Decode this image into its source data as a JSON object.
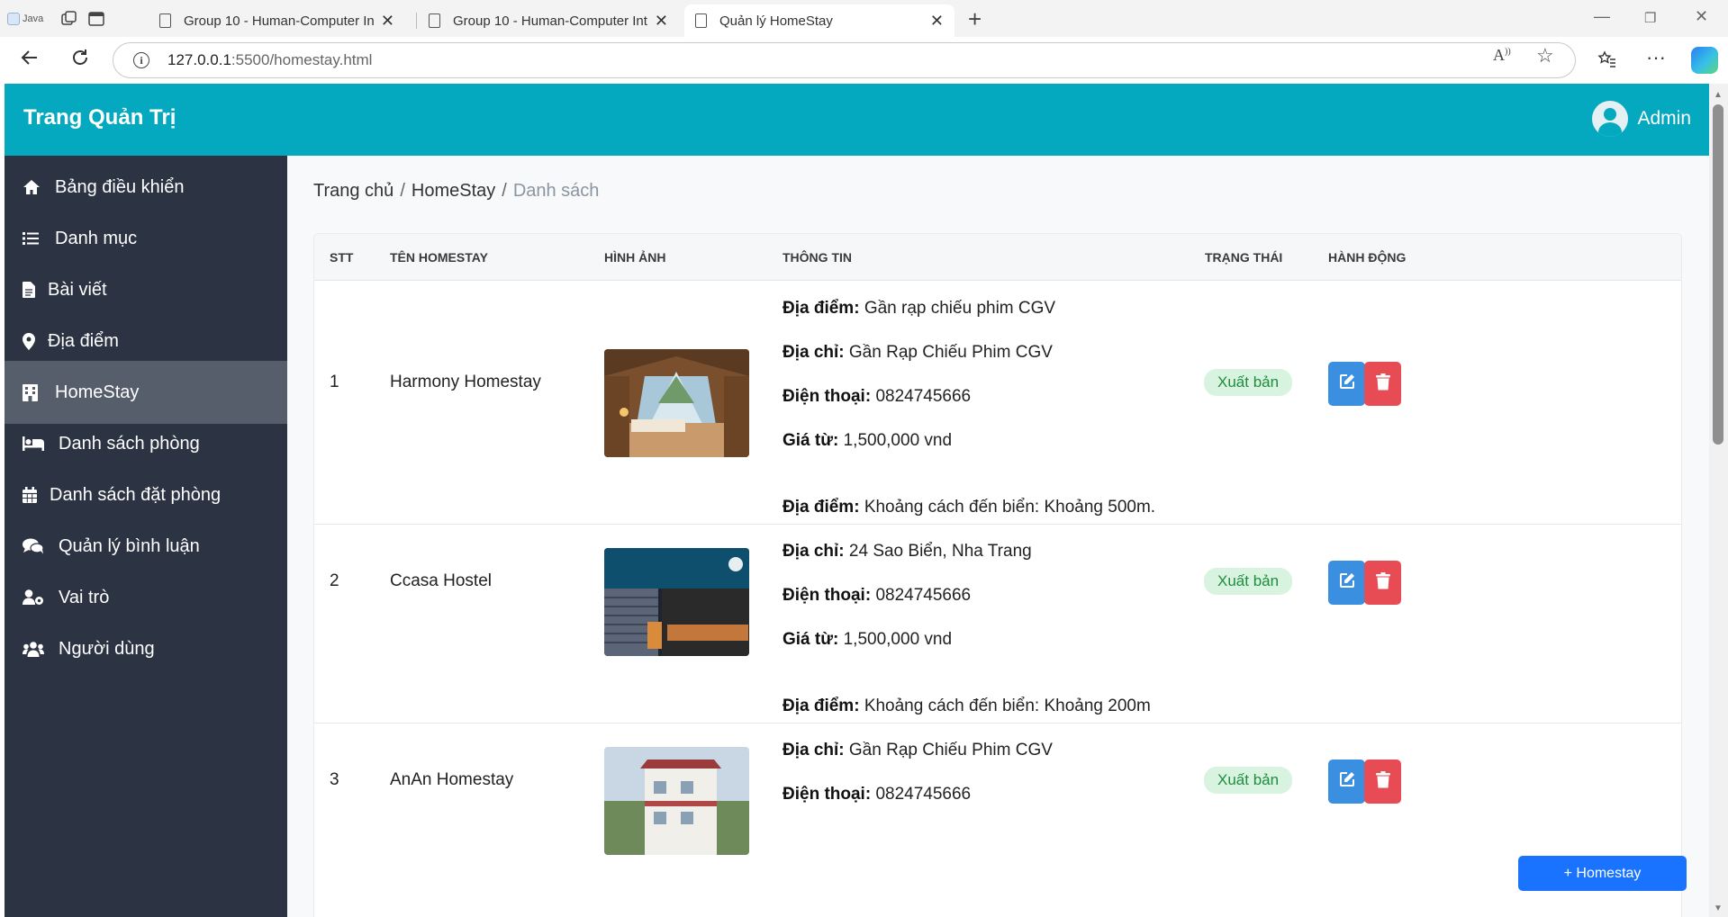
{
  "browser": {
    "first_tab_label": "Java",
    "tabs": [
      {
        "title": "Group 10 - Human-Computer Inte"
      },
      {
        "title": "Group 10 - Human-Computer Inte"
      },
      {
        "title": "Quản lý HomeStay"
      }
    ],
    "url_host": "127.0.0.1",
    "url_rest": ":5500/homestay.html"
  },
  "header": {
    "brand": "Trang Quản Trị",
    "user": "Admin"
  },
  "sidebar": {
    "items": [
      {
        "label": "Bảng điều khiển",
        "icon": "home-icon"
      },
      {
        "label": "Danh mục",
        "icon": "list-icon"
      },
      {
        "label": "Bài viết",
        "icon": "file-icon"
      },
      {
        "label": "Địa điểm",
        "icon": "map-pin-icon"
      },
      {
        "label": "HomeStay",
        "icon": "building-icon"
      },
      {
        "label": "Danh sách phòng",
        "icon": "bed-icon"
      },
      {
        "label": "Danh sách đặt phòng",
        "icon": "calendar-icon"
      },
      {
        "label": "Quản lý bình luận",
        "icon": "comments-icon"
      },
      {
        "label": "Vai trò",
        "icon": "user-cog-icon"
      },
      {
        "label": "Người dùng",
        "icon": "users-icon"
      }
    ],
    "active_index": 4
  },
  "breadcrumb": {
    "home": "Trang chủ",
    "section": "HomeStay",
    "current": "Danh sách"
  },
  "table": {
    "headers": {
      "stt": "STT",
      "name": "TÊN HOMESTAY",
      "image": "HÌNH ẢNH",
      "info": "THÔNG TIN",
      "status": "TRẠNG THÁI",
      "actions": "HÀNH ĐỘNG"
    },
    "labels": {
      "location": "Địa điểm:",
      "address": "Địa chỉ:",
      "phone": "Điện thoại:",
      "price": "Giá từ:"
    },
    "rows": [
      {
        "stt": "1",
        "name": "Harmony Homestay",
        "location": "Gần rạp chiếu phim CGV",
        "address": "Gần Rạp Chiếu Phim CGV",
        "phone": "0824745666",
        "price": "1,500,000 vnd",
        "status": "Xuất bản"
      },
      {
        "stt": "2",
        "name": "Ccasa Hostel",
        "location": "Khoảng cách đến biển: Khoảng 500m.",
        "address": "24 Sao Biển, Nha Trang",
        "phone": "0824745666",
        "price": "1,500,000 vnd",
        "status": "Xuất bản"
      },
      {
        "stt": "3",
        "name": "AnAn Homestay",
        "location": "Khoảng cách đến biển: Khoảng 200m",
        "address": "Gần Rạp Chiếu Phim CGV",
        "phone": "0824745666",
        "price": "",
        "status": "Xuất bản"
      }
    ]
  },
  "add_button_label": "+ Homestay",
  "colors": {
    "header": "#04a9bf",
    "sidebar": "#2c3444",
    "sidebar_active": "#565d6b",
    "edit": "#3b8fe0",
    "delete": "#e74c55",
    "badge_bg": "#d8f3df",
    "badge_text": "#1e8e3e",
    "primary": "#1a73ff"
  }
}
